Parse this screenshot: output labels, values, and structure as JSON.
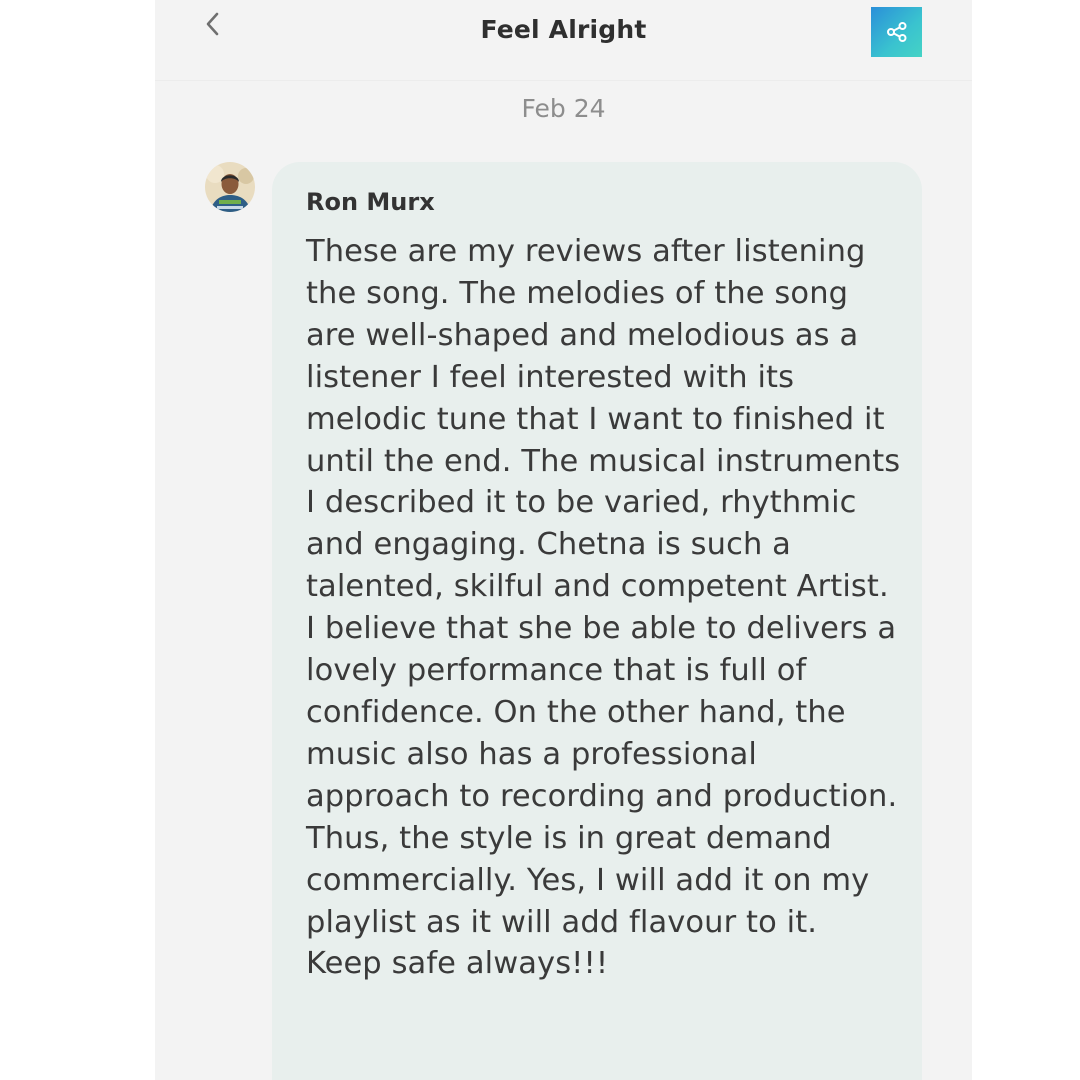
{
  "header": {
    "title": "Feel Alright",
    "back_icon": "chevron-left-icon",
    "share_icon": "share-icon",
    "share_colors": [
      "#2a8fd9",
      "#45d3c5"
    ]
  },
  "thread": {
    "date": "Feb 24",
    "comment": {
      "author": "Ron Murx",
      "text": "These are my reviews after listening the song. The melodies of the song are well-shaped and melodious as a listener I feel interested with its melodic tune that I want to finished it until the end. The musical instruments I described it to be varied, rhythmic and engaging. Chetna is such a talented, skilful and competent Artist. I believe that she be able to delivers a lovely performance that is full of confidence. On the other hand, the music also has a professional approach to recording and production. Thus, the style is in great demand commercially. Yes, I will add it on my playlist as it will add flavour to it. Keep safe always!!!"
    }
  }
}
